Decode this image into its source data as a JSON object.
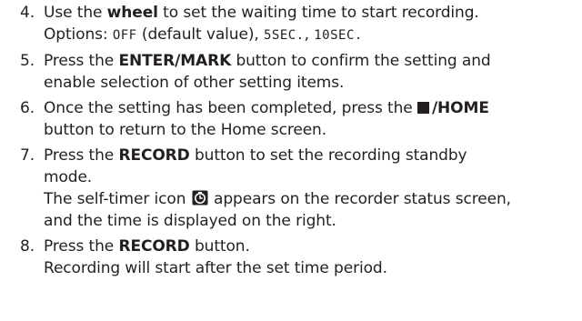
{
  "steps": [
    {
      "num": "4.",
      "l1_a": "Use the ",
      "l1_b": "wheel",
      "l1_c": " to set the waiting time to start recording.",
      "l2_a": "Options: ",
      "l2_b": "OFF",
      "l2_c": " (default value), ",
      "l2_d": "5SEC.",
      "l2_e": ", ",
      "l2_f": "10SEC.",
      "l2_g": ""
    },
    {
      "num": "5.",
      "l1_a": "Press the ",
      "l1_b": "ENTER/MARK",
      "l1_c": " button to confirm the setting and",
      "l2": "enable selection of other setting items."
    },
    {
      "num": "6.",
      "l1_a": "Once the setting has been completed, press the ",
      "l1_b": "/HOME",
      "l2": "button to return to the Home screen."
    },
    {
      "num": "7.",
      "l1_a": "Press the ",
      "l1_b": "RECORD",
      "l1_c": " button to set the recording standby",
      "l2": "mode.",
      "l3_a": "The self-timer icon ",
      "l3_b": " appears on the recorder status screen,",
      "l4": "and the time is displayed on the right."
    },
    {
      "num": "8.",
      "l1_a": "Press the ",
      "l1_b": "RECORD",
      "l1_c": " button.",
      "l2": "Recording will start after the set time period."
    }
  ],
  "icons": {
    "stop": "stop-square-icon",
    "self_timer": "self-timer-icon"
  },
  "colors": {
    "text": "#231f20",
    "background": "#ffffff"
  }
}
